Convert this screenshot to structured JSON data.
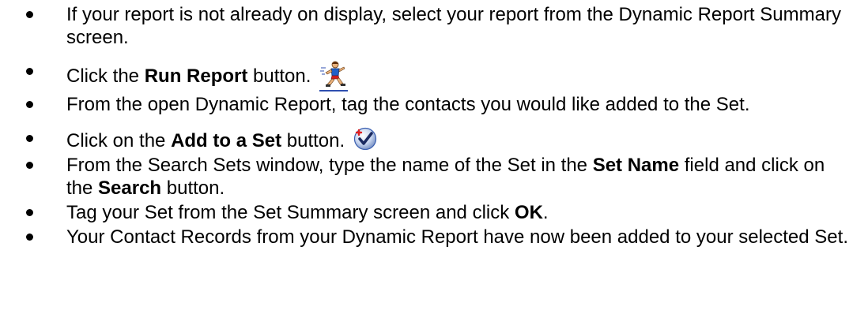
{
  "steps": [
    {
      "before": "If your report is not already on display, select your report from the Dynamic Report Summary screen."
    },
    {
      "before": "Click the ",
      "bold": "Run Report",
      "after": " button.",
      "icon": "running-man-icon"
    },
    {
      "before": "From the open Dynamic Report, tag the contacts you would like added to the Set."
    },
    {
      "before": "Click on the ",
      "bold": "Add to a Set",
      "after": " button.",
      "icon": "checkmark-add-icon"
    },
    {
      "before": "From the Search Sets window, type the name of the Set in the ",
      "bold": "Set Name",
      "middle": " field and click on the ",
      "bold2": "Search",
      "after": " button."
    },
    {
      "before": "Tag your Set from the Set Summary screen and click ",
      "bold": "OK",
      "after": "."
    },
    {
      "before": "Your Contact Records from your Dynamic Report have now been added to your selected Set."
    }
  ],
  "colors": {
    "text": "#000000",
    "link_underline": "#2f4fb0",
    "check_badge": "#3a5fb0",
    "check_plus": "#e02020"
  }
}
